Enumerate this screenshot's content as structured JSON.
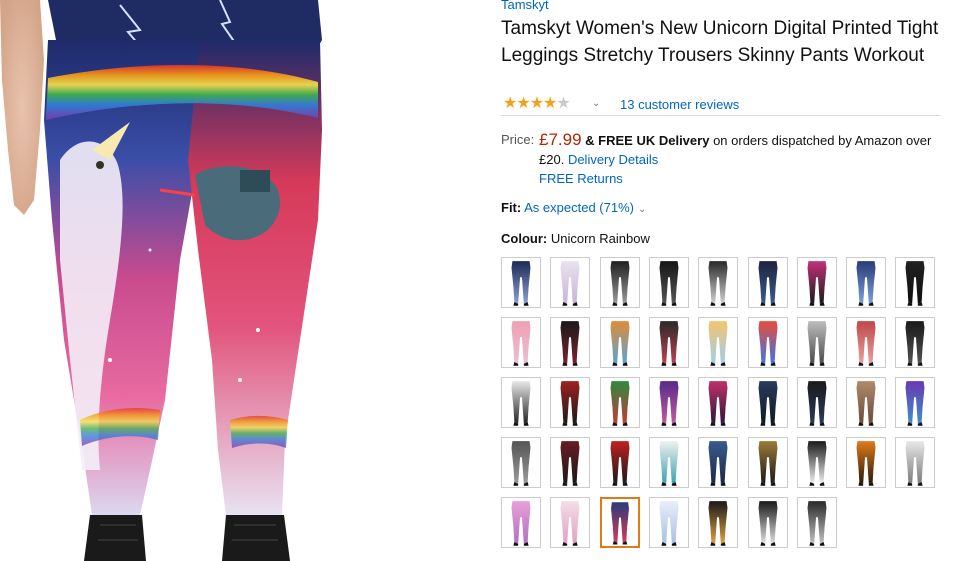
{
  "brand": "Tamskyt",
  "title": "Tamskyt Women's New Unicorn Digital Printed Tight Leggings Stretchy Trousers Skinny Pants Workout",
  "rating": {
    "stars": 4,
    "max": 5,
    "reviews_label": "13 customer reviews"
  },
  "price": {
    "label": "Price:",
    "amount": "£7.99",
    "delivery_bold": "& FREE UK Delivery",
    "delivery_text_1": "on orders dispatched by Amazon over",
    "delivery_text_2": "£20.",
    "delivery_details_link": "Delivery Details",
    "free_returns_link": "FREE Returns"
  },
  "fit": {
    "label": "Fit:",
    "value": "As expected (71%)"
  },
  "colour": {
    "label": "Colour:",
    "value": "Unicorn Rainbow"
  },
  "colors": {
    "link": "#0066c0",
    "price": "#b12704",
    "star": "#f0a31f",
    "selected_border": "#e47911"
  },
  "swatches": [
    {
      "name": "navy-galaxy",
      "top": "#1f2a55",
      "bottom": "#8aa0d8"
    },
    {
      "name": "white-pastel",
      "top": "#e9e3ef",
      "bottom": "#c7b3d9"
    },
    {
      "name": "black-white-print",
      "top": "#202020",
      "bottom": "#9a9a9a"
    },
    {
      "name": "black-shiny",
      "top": "#151515",
      "bottom": "#555555"
    },
    {
      "name": "black-white-arrows",
      "top": "#2a2a2a",
      "bottom": "#d0d0d0"
    },
    {
      "name": "blue-galaxy-dark",
      "top": "#1d2440",
      "bottom": "#3a5b8c"
    },
    {
      "name": "pink-black",
      "top": "#c2327a",
      "bottom": "#1a1a1a"
    },
    {
      "name": "blue-nebula",
      "top": "#2a3c7a",
      "bottom": "#7aa0d8"
    },
    {
      "name": "black-mesh",
      "top": "#222222",
      "bottom": "#0e0e0e"
    },
    {
      "name": "pink-floral",
      "top": "#f0a0b6",
      "bottom": "#e7c0d2"
    },
    {
      "name": "black-maroon",
      "top": "#1a1a1a",
      "bottom": "#7a2030"
    },
    {
      "name": "colourful-print",
      "top": "#e08a3a",
      "bottom": "#5aa5d0"
    },
    {
      "name": "black-floral",
      "top": "#2a2a2a",
      "bottom": "#c04050"
    },
    {
      "name": "pastel-cartoon",
      "top": "#f6c36f",
      "bottom": "#9bd0e8"
    },
    {
      "name": "rainbow-stripe",
      "top": "#e94c3c",
      "bottom": "#3c74e9"
    },
    {
      "name": "grey-comic",
      "top": "#bdbdbd",
      "bottom": "#4a4a4a"
    },
    {
      "name": "red-print",
      "top": "#c04848",
      "bottom": "#e8a0a0"
    },
    {
      "name": "black-skull",
      "top": "#1a1a1a",
      "bottom": "#505050"
    },
    {
      "name": "white-black-cat",
      "top": "#e8e8e8",
      "bottom": "#222222"
    },
    {
      "name": "red-black-floral",
      "top": "#a02020",
      "bottom": "#1a1a1a"
    },
    {
      "name": "green-camo",
      "top": "#2e8a3c",
      "bottom": "#c03b3b"
    },
    {
      "name": "purple-galaxy",
      "top": "#5a2a8a",
      "bottom": "#c05aa0"
    },
    {
      "name": "pink-galaxy",
      "top": "#c0306a",
      "bottom": "#2a1a3a"
    },
    {
      "name": "navy-denim",
      "top": "#2a3a5a",
      "bottom": "#101828"
    },
    {
      "name": "black-plain",
      "top": "#1a1a1a",
      "bottom": "#2a3a5a"
    },
    {
      "name": "tan-plaid",
      "top": "#b08a6a",
      "bottom": "#6a4a3a"
    },
    {
      "name": "purple-nebula",
      "top": "#6a3ab0",
      "bottom": "#3a90d0"
    },
    {
      "name": "grey-black-print",
      "top": "#555555",
      "bottom": "#9a9a9a"
    },
    {
      "name": "maroon-black",
      "top": "#6a1a24",
      "bottom": "#1a1a1a"
    },
    {
      "name": "red-black-split",
      "top": "#c02020",
      "bottom": "#1a1a1a"
    },
    {
      "name": "white-teal-panel",
      "top": "#f0f0f0",
      "bottom": "#3aa0b0"
    },
    {
      "name": "denim-blue",
      "top": "#3a5a8a",
      "bottom": "#1a2a4a"
    },
    {
      "name": "gold-black-print",
      "top": "#9a7a3a",
      "bottom": "#1a1a1a"
    },
    {
      "name": "black-white-stripe",
      "top": "#1a1a1a",
      "bottom": "#f0f0f0"
    },
    {
      "name": "tiger-orange",
      "top": "#e07a1a",
      "bottom": "#2a1a0a"
    },
    {
      "name": "white-snake",
      "top": "#e8e8e8",
      "bottom": "#7a7a7a"
    },
    {
      "name": "pink-pastel-print",
      "top": "#e8a0d8",
      "bottom": "#b070c0"
    },
    {
      "name": "white-pink-print",
      "top": "#f5dde8",
      "bottom": "#e0a0c0"
    },
    {
      "name": "unicorn-rainbow",
      "top": "#2a3b7a",
      "bottom": "#d63a5a"
    },
    {
      "name": "white-light-blue",
      "top": "#e8eef8",
      "bottom": "#a8c0e0"
    },
    {
      "name": "black-colourful-dots",
      "top": "#1a1a1a",
      "bottom": "#e0a040"
    },
    {
      "name": "black-white-dots",
      "top": "#1a1a1a",
      "bottom": "#e0e0e0"
    },
    {
      "name": "black-white-check",
      "top": "#2a2a2a",
      "bottom": "#c0c0c0"
    }
  ],
  "selected_swatch": "unicorn-rainbow"
}
